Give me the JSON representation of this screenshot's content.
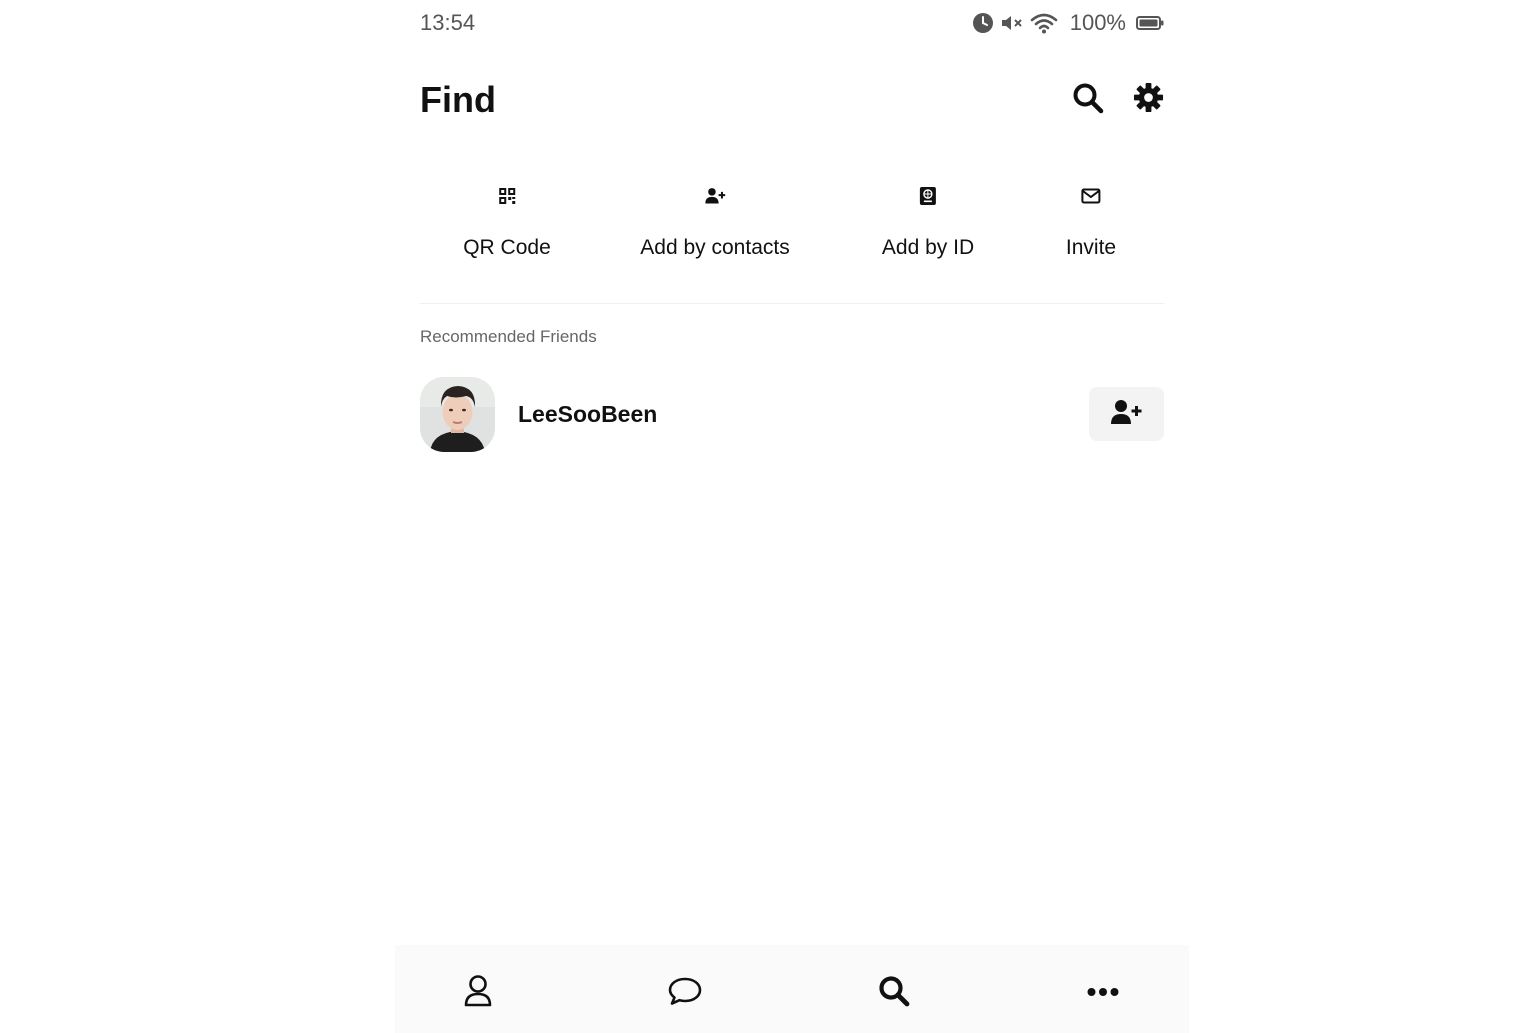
{
  "status_bar": {
    "time": "13:54",
    "battery_percent": "100%",
    "icons": [
      "alarm-icon",
      "mute-icon",
      "wifi-icon",
      "battery-icon"
    ]
  },
  "header": {
    "title": "Find",
    "actions": [
      "search-icon",
      "gear-icon"
    ]
  },
  "quick_actions": [
    {
      "label": "QR Code",
      "icon": "qr-code-icon"
    },
    {
      "label": "Add by contacts",
      "icon": "user-plus-icon"
    },
    {
      "label": "Add by ID",
      "icon": "id-book-icon"
    },
    {
      "label": "Invite",
      "icon": "envelope-icon"
    }
  ],
  "recommended": {
    "section_label": "Recommended Friends",
    "friends": [
      {
        "name": "LeeSooBeen",
        "avatar": "profile-photo",
        "action_icon": "user-plus-icon"
      }
    ]
  },
  "bottom_nav": [
    {
      "icon": "person-icon",
      "active": false
    },
    {
      "icon": "chat-bubble-icon",
      "active": false
    },
    {
      "icon": "search-icon",
      "active": true
    },
    {
      "icon": "more-dots-icon",
      "active": false
    }
  ],
  "colors": {
    "text_primary": "#111111",
    "text_secondary": "#666666",
    "status_text": "#555555",
    "button_bg": "#f3f3f3",
    "nav_bg": "#fafafa",
    "divider": "#efefef"
  }
}
